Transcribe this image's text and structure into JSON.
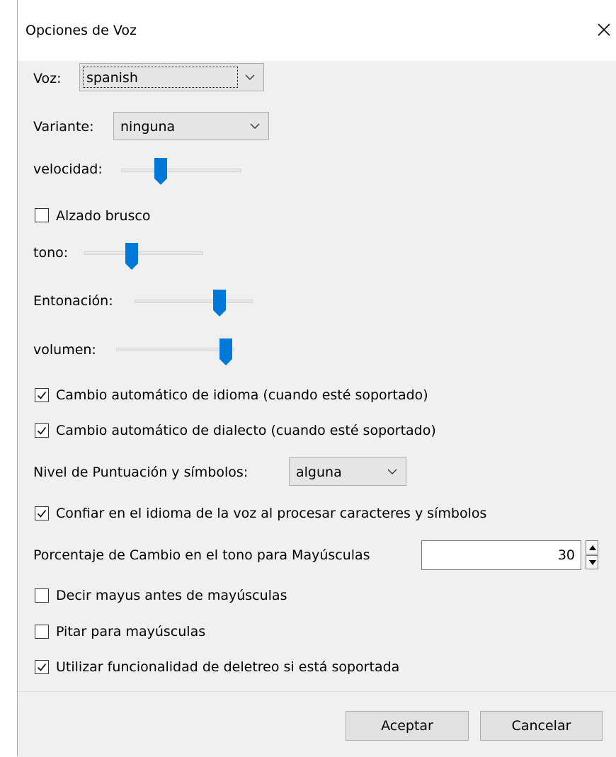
{
  "window": {
    "title": "Opciones de Voz"
  },
  "voice": {
    "label": "Voz:",
    "value": "spanish"
  },
  "variant": {
    "label": "Variante:",
    "value": "ninguna"
  },
  "rate": {
    "label": "velocidad:",
    "percent": 0.33
  },
  "rate_boost": {
    "label": "Alzado brusco",
    "checked": false
  },
  "pitch": {
    "label": "tono:",
    "percent": 0.4
  },
  "inflection": {
    "label": "Entonación:",
    "percent": 0.72
  },
  "volume": {
    "label": "volumen:",
    "percent": 0.93
  },
  "auto_language": {
    "label": "Cambio automático de idioma (cuando esté soportado)",
    "checked": true
  },
  "auto_dialect": {
    "label": "Cambio automático de dialecto (cuando esté soportado)",
    "checked": true
  },
  "punctuation": {
    "label": "Nivel de Puntuación y símbolos:",
    "value": "alguna"
  },
  "trust_voice_language": {
    "label": "Confiar en el idioma de la voz al procesar caracteres y símbolos",
    "checked": true
  },
  "cap_pitch_change": {
    "label": "Porcentaje de Cambio en el tono para Mayúsculas",
    "value": "30"
  },
  "say_cap": {
    "label": "Decir mayus antes de mayúsculas",
    "checked": false
  },
  "beep_caps": {
    "label": "Pitar para mayúsculas",
    "checked": false
  },
  "spelling": {
    "label": "Utilizar funcionalidad de deletreo si está soportada",
    "checked": true
  },
  "buttons": {
    "ok": "Aceptar",
    "cancel": "Cancelar"
  },
  "colors": {
    "accent": "#0078d7",
    "window_bg": "#f0f0f0",
    "titlebar_bg": "#ffffff"
  }
}
